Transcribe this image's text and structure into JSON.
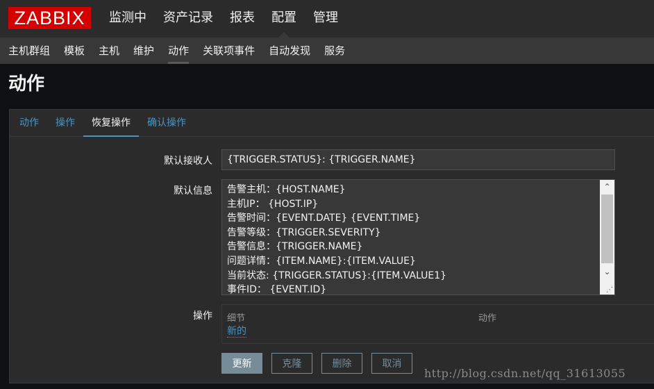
{
  "logo": "ZABBIX",
  "main_menu": [
    "监测中",
    "资产记录",
    "报表",
    "配置",
    "管理"
  ],
  "submenu": [
    "主机群组",
    "模板",
    "主机",
    "维护",
    "动作",
    "关联项事件",
    "自动发现",
    "服务"
  ],
  "page_title": "动作",
  "tabs": [
    "动作",
    "操作",
    "恢复操作",
    "确认操作"
  ],
  "form": {
    "recipient_label": "默认接收人",
    "recipient_value": "{TRIGGER.STATUS}: {TRIGGER.NAME}",
    "message_label": "默认信息",
    "message_lines": [
      "告警主机：{HOST.NAME}",
      "主机IP： {HOST.IP}",
      "告警时间：{EVENT.DATE} {EVENT.TIME}",
      "告警等级：{TRIGGER.SEVERITY}",
      "告警信息：{TRIGGER.NAME}",
      "问题详情：{ITEM.NAME}:{ITEM.VALUE}",
      "当前状态: {TRIGGER.STATUS}:{ITEM.VALUE1}",
      "事件ID： {EVENT.ID}"
    ],
    "operations_label": "操作",
    "col_details": "细节",
    "col_action": "动作",
    "new_link": "新的"
  },
  "buttons": {
    "update": "更新",
    "clone": "克隆",
    "delete": "删除",
    "cancel": "取消"
  },
  "watermark": "http://blog.csdn.net/qq_31613055",
  "colors": {
    "logo_red": "#d40000",
    "link_blue": "#4796c4",
    "button": "#768d99"
  }
}
